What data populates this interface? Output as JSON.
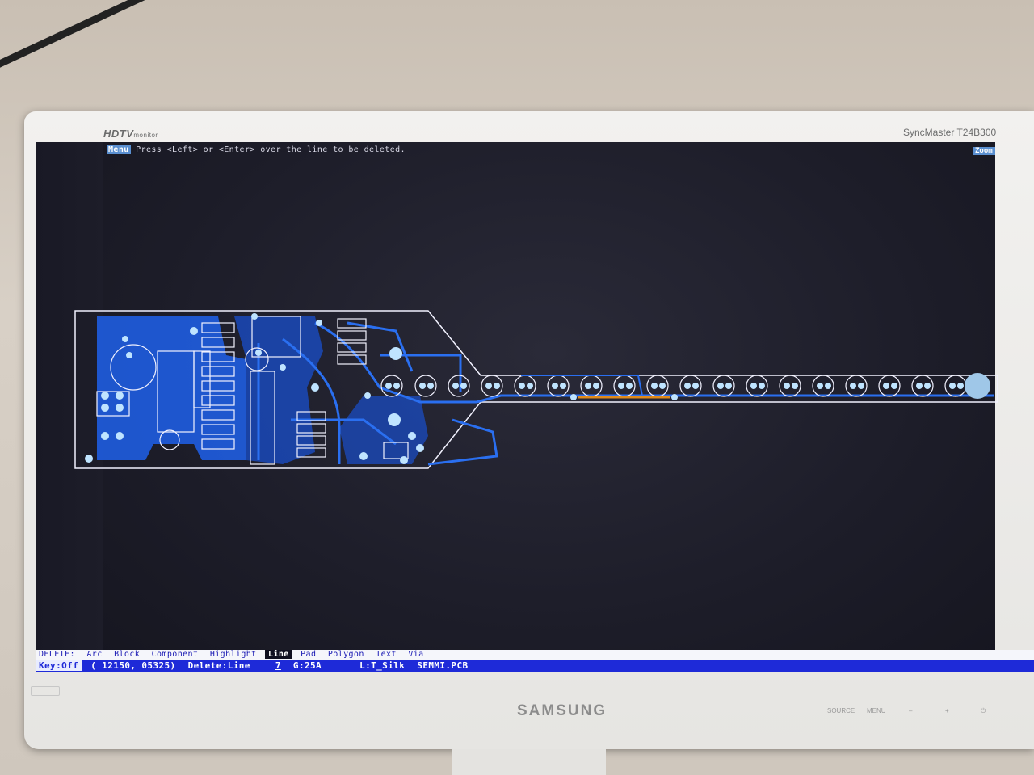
{
  "monitor": {
    "left_brand": "HDTV",
    "left_brand_small": "monitor",
    "model": "SyncMaster T24B300",
    "logo": "SAMSUNG",
    "controls": [
      "SOURCE",
      "MENU",
      "–",
      "+",
      "⏻"
    ]
  },
  "top_bar": {
    "menu_label": "Menu",
    "prompt": "Press <Left> or <Enter> over the line to be deleted.",
    "zoom_label": "Zoom"
  },
  "delete_menu": {
    "title": "DELETE:",
    "items": [
      "Arc",
      "Block",
      "Component",
      "Highlight",
      "Line",
      "Pad",
      "Polygon",
      "Text",
      "Via"
    ],
    "selected": "Line"
  },
  "status_bar": {
    "key": "Key:Off",
    "coords": "( 12150, 05325)",
    "mode": "Delete:Line",
    "grid_num": "7",
    "grid": "G:25A",
    "layer": "L:T_Silk",
    "file": "SEMMI.PCB"
  },
  "colors": {
    "screen_bg": "#1d1d29",
    "trace_blue": "#2a6ff0",
    "silk_white": "#f2f2ff",
    "pad_cyan": "#bfe4ff",
    "highlight_orange": "#e08a1a",
    "status_blue": "#1e2ad8"
  }
}
